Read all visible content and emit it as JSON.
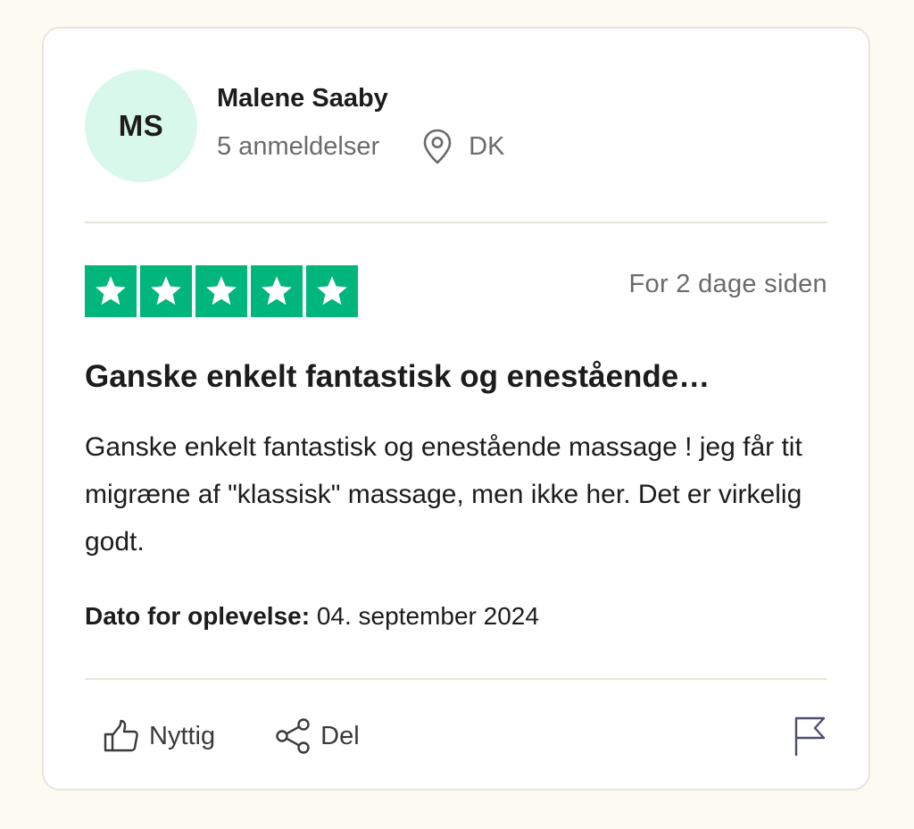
{
  "reviewer": {
    "initials": "MS",
    "name": "Malene Saaby",
    "review_count": "5 anmeldelser",
    "country": "DK"
  },
  "rating": {
    "stars": 5,
    "max": 5,
    "color": "#00b67a"
  },
  "posted_ago": "For 2 dage siden",
  "review": {
    "title": "Ganske enkelt fantastisk og enestående…",
    "body": "Ganske enkelt fantastisk og enestående massage ! jeg får tit migræne af \"klassisk\" massage, men ikke her. Det er virkelig godt."
  },
  "experience": {
    "label": "Dato for oplevelse:",
    "date": "04. september 2024"
  },
  "actions": {
    "useful_label": "Nyttig",
    "share_label": "Del"
  },
  "icons": {
    "location": "location-pin-icon",
    "useful": "thumbs-up-icon",
    "share": "share-icon",
    "report": "flag-icon",
    "star": "star-icon"
  },
  "colors": {
    "avatar_bg": "#d8f8ec",
    "star_green": "#00b67a",
    "page_bg": "#fbfaf3"
  }
}
